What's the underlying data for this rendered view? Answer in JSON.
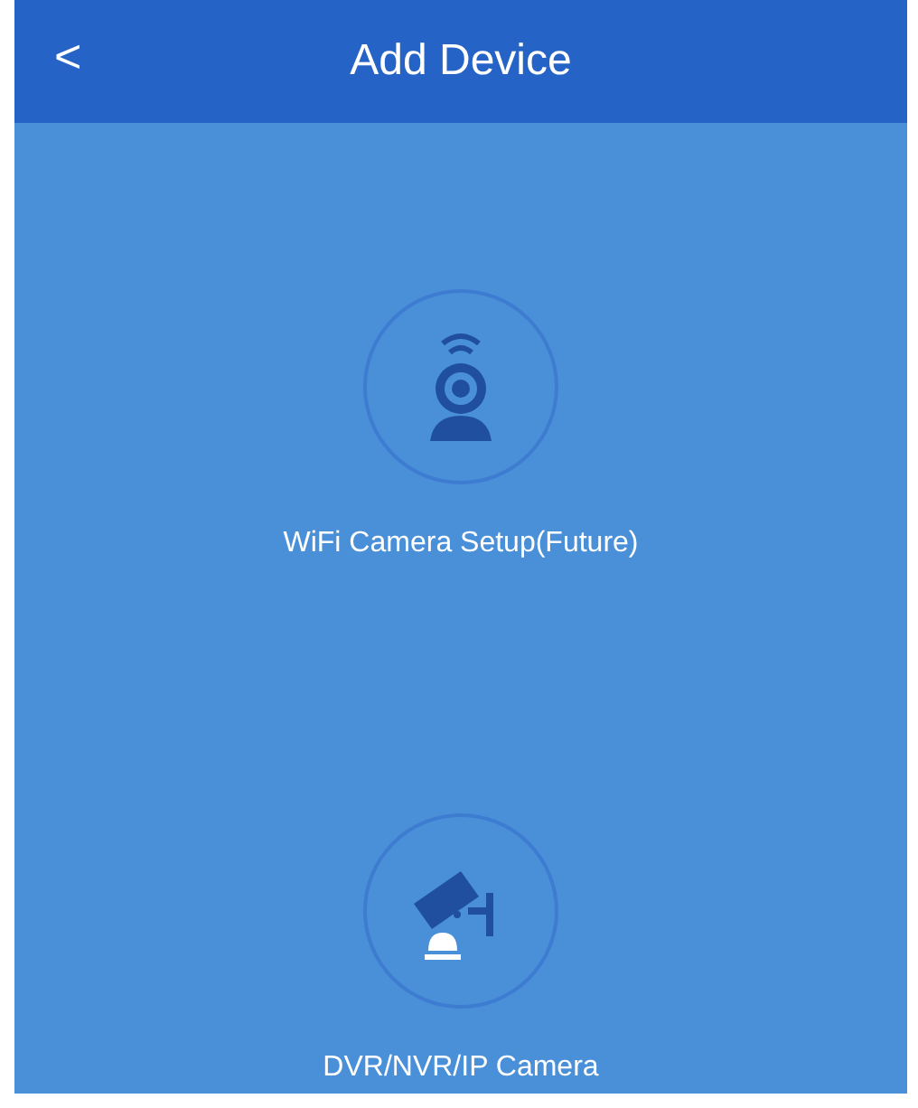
{
  "header": {
    "back": "<",
    "title": "Add Device"
  },
  "options": [
    {
      "kind": "wifi-camera",
      "label": "WiFi Camera Setup(Future)"
    },
    {
      "kind": "cctv-camera",
      "label": "DVR/NVR/IP Camera"
    }
  ]
}
